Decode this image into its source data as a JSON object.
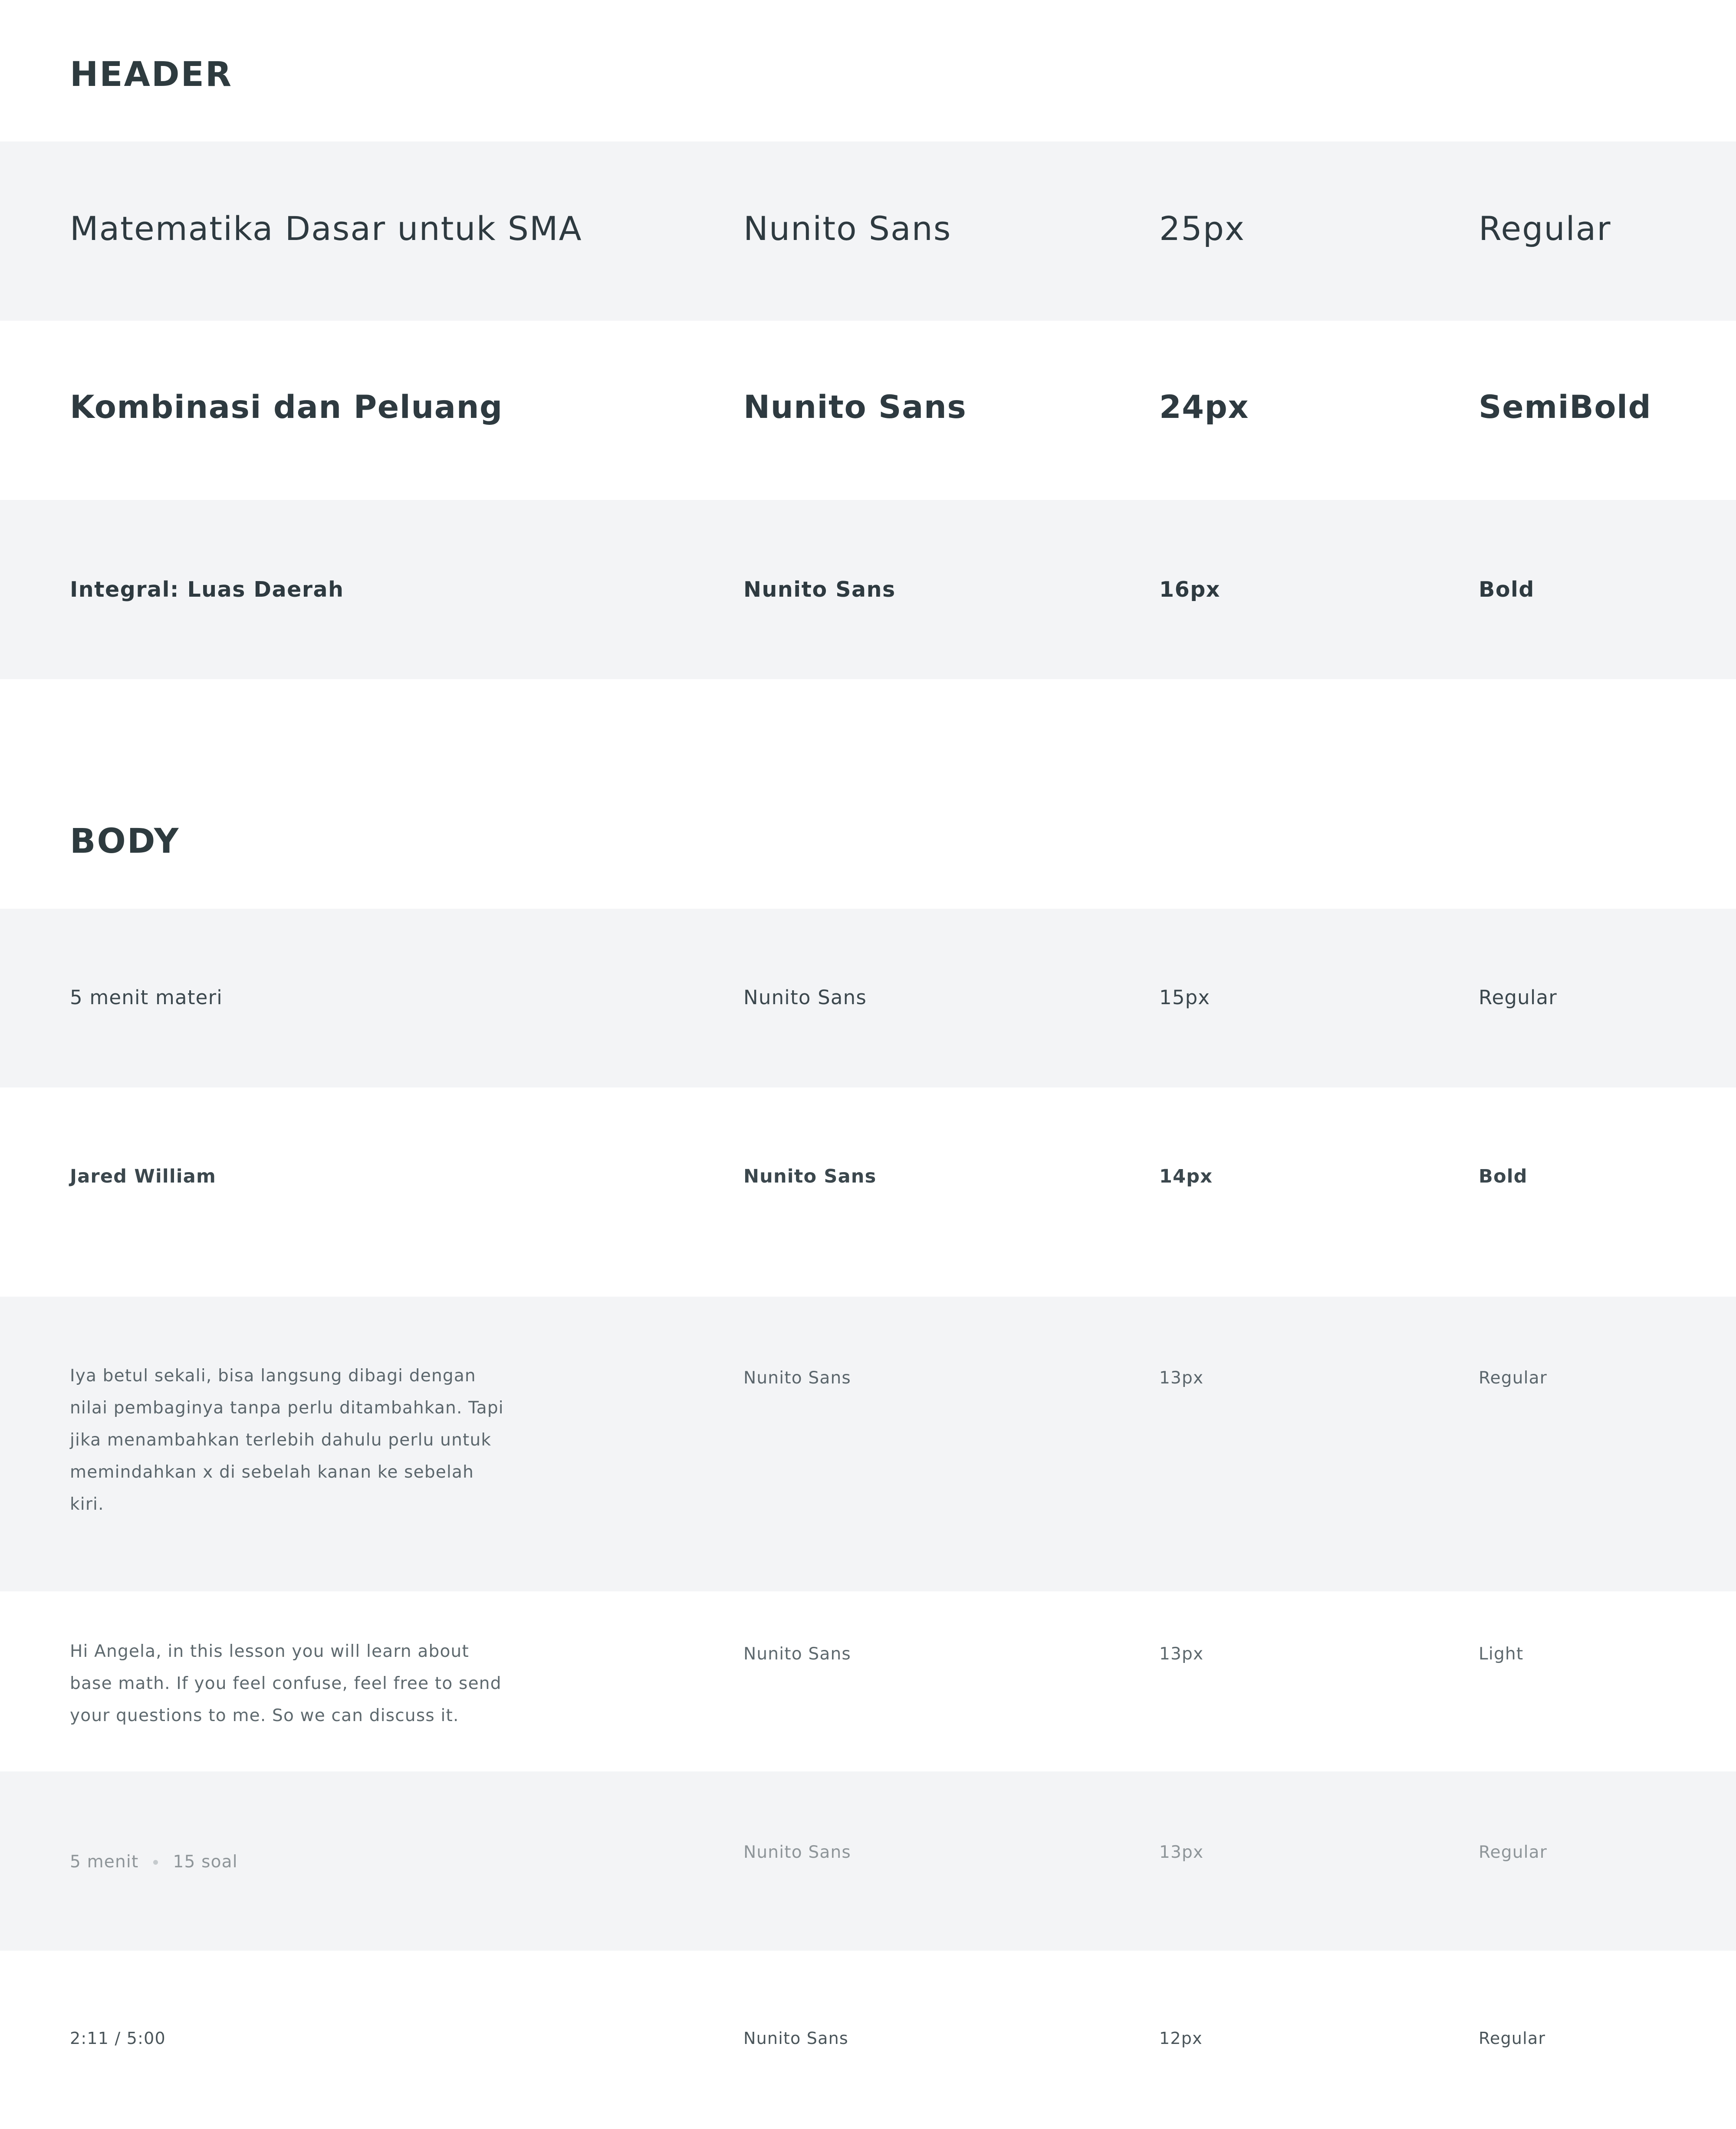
{
  "header": {
    "title": "HEADER",
    "rows": [
      {
        "sample": "Matematika Dasar untuk SMA",
        "font": "Nunito Sans",
        "size": "25px",
        "weight": "Regular"
      },
      {
        "sample": "Kombinasi dan Peluang",
        "font": "Nunito Sans",
        "size": "24px",
        "weight": "SemiBold"
      },
      {
        "sample": "Integral: Luas Daerah",
        "font": "Nunito Sans",
        "size": "16px",
        "weight": "Bold"
      }
    ]
  },
  "body": {
    "title": "BODY",
    "rows": [
      {
        "sample": "5 menit materi",
        "font": "Nunito Sans",
        "size": "15px",
        "weight": "Regular"
      },
      {
        "sample": "Jared William",
        "font": "Nunito Sans",
        "size": "14px",
        "weight": "Bold"
      },
      {
        "sample": "Iya betul sekali, bisa langsung dibagi dengan nilai pembaginya tanpa perlu ditambahkan. Tapi jika menambahkan terlebih dahulu perlu untuk memindahkan x di sebelah kanan ke sebelah kiri.",
        "font": "Nunito Sans",
        "size": "13px",
        "weight": "Regular"
      },
      {
        "sample": "Hi Angela, in this lesson you will learn about base math. If you feel confuse, feel free to send your questions to me. So we can discuss it.",
        "font": "Nunito Sans",
        "size": "13px",
        "weight": "Light"
      },
      {
        "sample_a": "5 menit",
        "sample_b": "15 soal",
        "font": "Nunito Sans",
        "size": "13px",
        "weight": "Regular"
      },
      {
        "sample": "2:11 / 5:00",
        "font": "Nunito Sans",
        "size": "12px",
        "weight": "Regular"
      }
    ]
  }
}
